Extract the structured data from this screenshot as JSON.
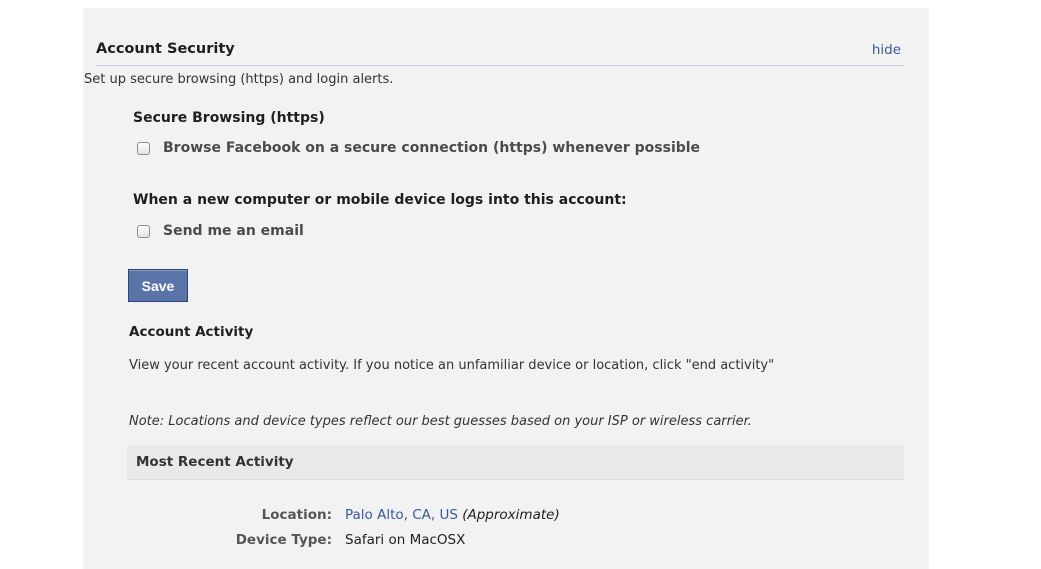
{
  "account_security": {
    "title": "Account Security",
    "hide_label": "hide",
    "description": "Set up secure browsing (https) and login alerts."
  },
  "secure_browsing": {
    "heading": "Secure Browsing (https)",
    "checkbox_label": "Browse Facebook on a secure connection (https) whenever possible"
  },
  "login_alerts": {
    "heading": "When a new computer or mobile device logs into this account:",
    "checkbox_label": "Send me an email"
  },
  "save_label": "Save",
  "account_activity": {
    "title": "Account Activity",
    "description": "View your recent account activity. If you notice an unfamiliar device or location, click \"end activity\"",
    "note": "Note: Locations and device types reflect our best guesses based on your ISP or wireless carrier."
  },
  "recent_activity": {
    "title": "Most Recent Activity",
    "location_label": "Location:",
    "location_value": "Palo Alto, CA, US",
    "location_qualifier": "(Approximate)",
    "device_label": "Device Type:",
    "device_value": "Safari on MacOSX"
  },
  "colors": {
    "link": "#3b5998",
    "button": "#5b74a8",
    "panel_background": "#f2f2f2"
  }
}
